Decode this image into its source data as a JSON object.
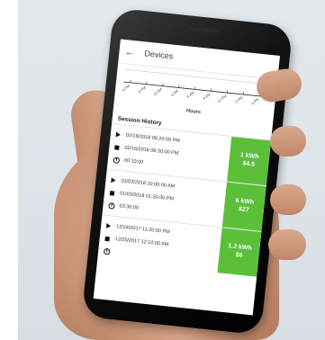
{
  "header": {
    "title": "Devices"
  },
  "chart": {
    "xlabel": "Hours",
    "ticks": [
      "6 PM",
      "9 PM",
      "12 AM",
      "3 AM",
      "6 AM",
      "9 AM",
      "12 PM",
      "3 PM",
      "6 PM"
    ],
    "right_value": "0"
  },
  "session_history": {
    "title": "Session History",
    "sessions": [
      {
        "start": "02/16/2018 06:20:00 PM",
        "end": "02/16/2018 06:30:00 PM",
        "duration": "00:10:00",
        "energy": "1 kWh",
        "cost": "$4.5"
      },
      {
        "start": "01/03/2018 10:00:00 AM",
        "end": "01/03/2018 01:30:00 PM",
        "duration": "03:30:00",
        "energy": "6 kWh",
        "cost": "$27"
      },
      {
        "start": "12/24/2017 11:20:00 PM",
        "end": "12/25/2017 12:10:00 AM",
        "duration": "",
        "energy": "1.2 kWh",
        "cost": "$6"
      }
    ]
  },
  "colors": {
    "accent": "#5bbf3a"
  }
}
